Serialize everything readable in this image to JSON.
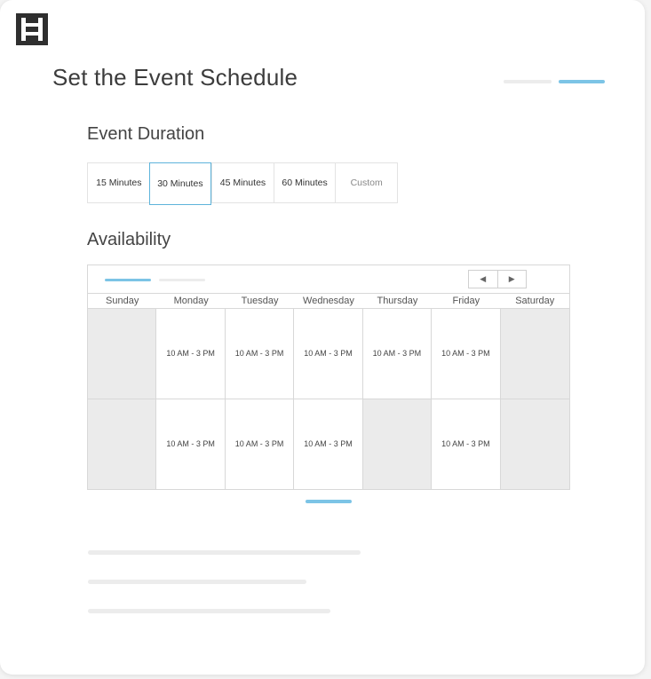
{
  "header": {
    "title": "Set the Event Schedule",
    "logo_icon": "h-logo-icon",
    "step_colors": {
      "inactive": "#ececec",
      "active": "#7cc4e6"
    }
  },
  "duration": {
    "label": "Event Duration",
    "options": [
      "15 Minutes",
      "30 Minutes",
      "45 Minutes",
      "60 Minutes",
      "Custom"
    ],
    "selected": "30 Minutes",
    "accent": "#5eb4db"
  },
  "availability": {
    "label": "Availability",
    "nav": {
      "prev_icon": "chevron-left-icon",
      "next_icon": "chevron-right-icon",
      "prev_glyph": "◀",
      "next_glyph": "▶"
    },
    "days": [
      "Sunday",
      "Monday",
      "Tuesday",
      "Wednesday",
      "Thursday",
      "Friday",
      "Saturday"
    ],
    "weeks": [
      [
        "",
        "10 AM - 3 PM",
        "10 AM - 3 PM",
        "10 AM - 3 PM",
        "10 AM - 3 PM",
        "10 AM - 3 PM",
        ""
      ],
      [
        "",
        "10 AM - 3 PM",
        "10 AM - 3 PM",
        "10 AM - 3 PM",
        "",
        "10 AM - 3 PM",
        ""
      ]
    ],
    "unavailable_color": "#ebebeb"
  }
}
